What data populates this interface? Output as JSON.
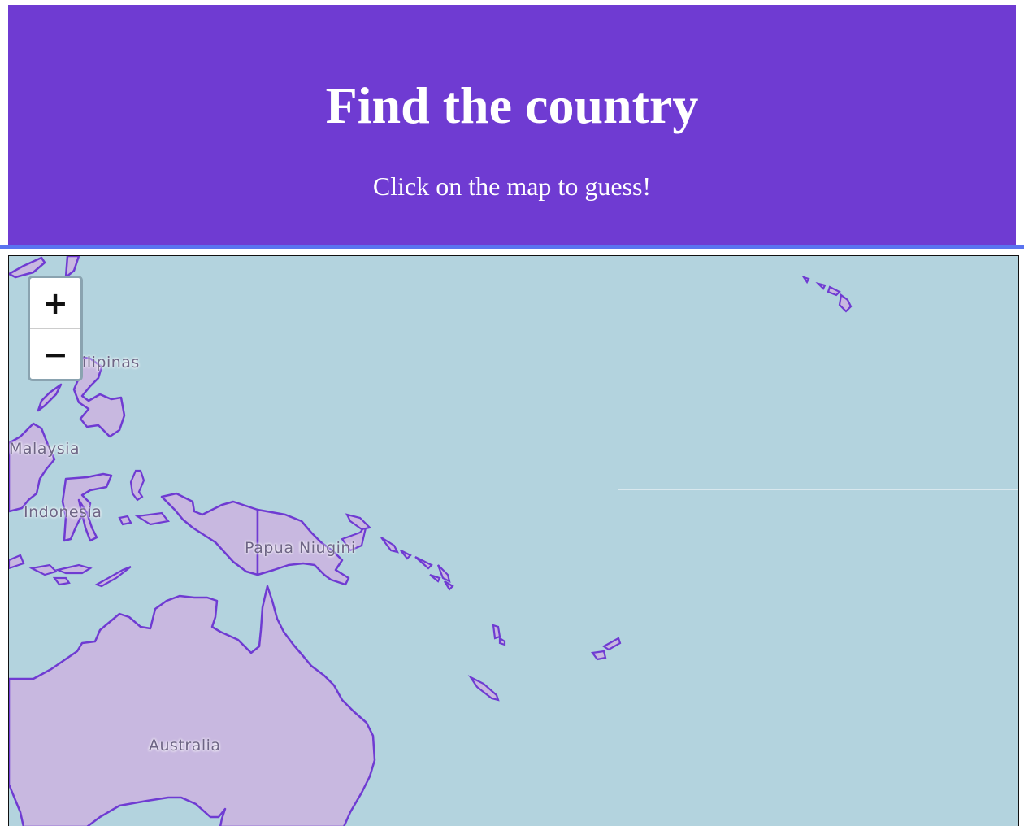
{
  "header": {
    "title": "Find the country",
    "subtitle": "Click on the map to guess!"
  },
  "map": {
    "labels": {
      "philippines": "Filipinas",
      "malaysia": "Malaysia",
      "indonesia": "Indonesia",
      "papua": "Papua Niugini",
      "australia": "Australia"
    },
    "zoom_in_label": "+",
    "zoom_out_label": "−"
  },
  "colors": {
    "header_bg": "#6f3bd2",
    "ocean": "#b3d3de",
    "land_fill": "#c8b8e0",
    "border": "#6f3bd2"
  }
}
